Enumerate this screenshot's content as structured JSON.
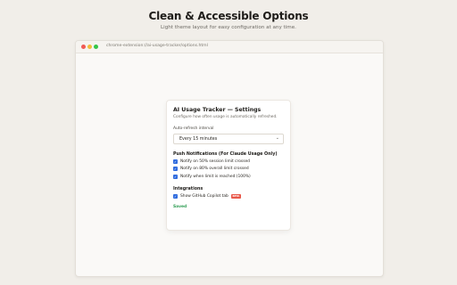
{
  "hero": {
    "title": "Clean & Accessible Options",
    "subtitle": "Light theme layout for easy configuration at any time."
  },
  "browser": {
    "url": "chrome-extension://ai-usage-tracker/options.html"
  },
  "card": {
    "title": "AI Usage Tracker — Settings",
    "description": "Configure how often usage is automatically refreshed.",
    "refresh": {
      "label": "Auto-refresh interval",
      "value": "Every 15 minutes"
    },
    "push": {
      "title": "Push Notifications (For Claude Usage Only)",
      "items": [
        {
          "label": "Notify on 50% session limit crossed",
          "checked": true
        },
        {
          "label": "Notify on 80% overall limit crossed",
          "checked": true
        },
        {
          "label": "Notify when limit is reached (100%)",
          "checked": true
        }
      ]
    },
    "integrations": {
      "title": "Integrations",
      "items": [
        {
          "label": "Show GitHub Copilot tab",
          "checked": true,
          "badge": "BETA"
        }
      ]
    },
    "status": "Saved"
  },
  "colors": {
    "accent": "#2f6bde",
    "saved": "#2a9b50",
    "badge": "#e8584a"
  }
}
